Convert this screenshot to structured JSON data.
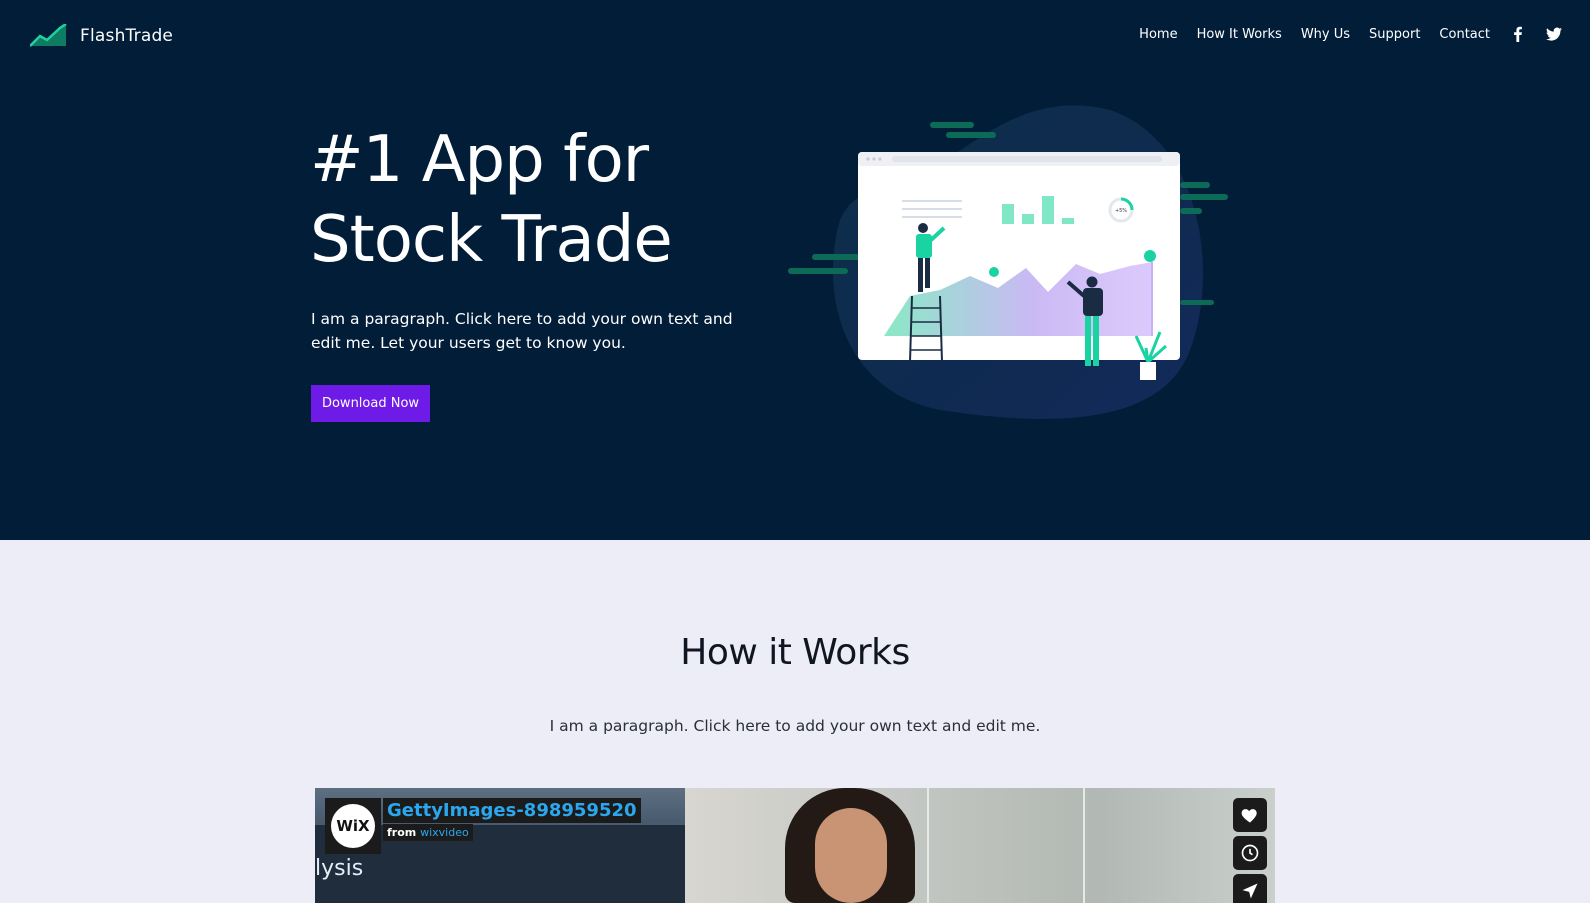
{
  "nav": {
    "brand": "FlashTrade",
    "items": [
      {
        "label": "Home"
      },
      {
        "label": "How It Works"
      },
      {
        "label": "Why Us"
      },
      {
        "label": "Support"
      },
      {
        "label": "Contact"
      }
    ],
    "social": [
      {
        "icon": "facebook-icon"
      },
      {
        "icon": "twitter-icon"
      }
    ]
  },
  "hero": {
    "title_line1": "#1 App for",
    "title_line2": "Stock Trade",
    "paragraph": "I am a paragraph. Click here to add your own text and edit me. Let your users get to know you.",
    "button_label": "Download Now",
    "illustration_stat": "+5%"
  },
  "how_it_works": {
    "title": "How it Works",
    "paragraph": "I am a paragraph. Click here to add your own text and edit me."
  },
  "video": {
    "title": "GettyImages-898959520",
    "from_label": "from",
    "source": "wixvideo",
    "logo_text": "WiX",
    "screen_text": "lysis",
    "actions": [
      {
        "icon": "heart-icon"
      },
      {
        "icon": "clock-icon"
      },
      {
        "icon": "send-icon"
      }
    ]
  },
  "colors": {
    "hero_bg": "#011d38",
    "page_bg": "#ecedf6",
    "button": "#6e1be8",
    "accent_green": "#19d3a2",
    "accent_purple": "#b892f0",
    "video_title": "#2aa7ee"
  }
}
